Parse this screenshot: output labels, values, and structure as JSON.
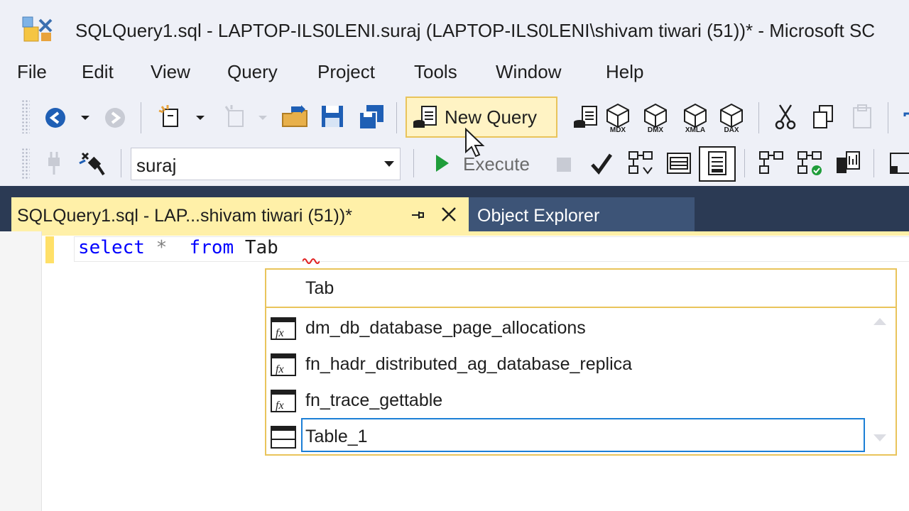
{
  "window": {
    "title": "SQLQuery1.sql - LAPTOP-ILS0LENI.suraj (LAPTOP-ILS0LENI\\shivam tiwari (51))* - Microsoft SC"
  },
  "menu": [
    "File",
    "Edit",
    "View",
    "Query",
    "Project",
    "Tools",
    "Window",
    "Help"
  ],
  "toolbar": {
    "new_query_label": "New Query",
    "database_value": "suraj",
    "execute_label": "Execute",
    "mdx_label": "MDX",
    "dmx_label": "DMX",
    "xmla_label": "XMLA",
    "dax_label": "DAX"
  },
  "tabs": {
    "active_label": "SQLQuery1.sql - LAP...shivam tiwari (51))*",
    "object_explorer_label": "Object Explorer"
  },
  "editor": {
    "keyword_select": "select",
    "star": "*",
    "keyword_from": "from",
    "ident": "Tab"
  },
  "autocomplete": {
    "typed": "Tab",
    "items": [
      {
        "label": "dm_db_database_page_allocations",
        "icon": "table-function-icon"
      },
      {
        "label": "fn_hadr_distributed_ag_database_replica",
        "icon": "table-function-icon"
      },
      {
        "label": "fn_trace_gettable",
        "icon": "table-function-icon"
      },
      {
        "label": "Table_1",
        "icon": "table-icon",
        "selected": true
      }
    ]
  },
  "colors": {
    "accent_yellow": "#fff0a8",
    "selection_blue": "#1c7fd6",
    "tab_strip": "#2b3a54",
    "keyword": "#0000ff"
  }
}
